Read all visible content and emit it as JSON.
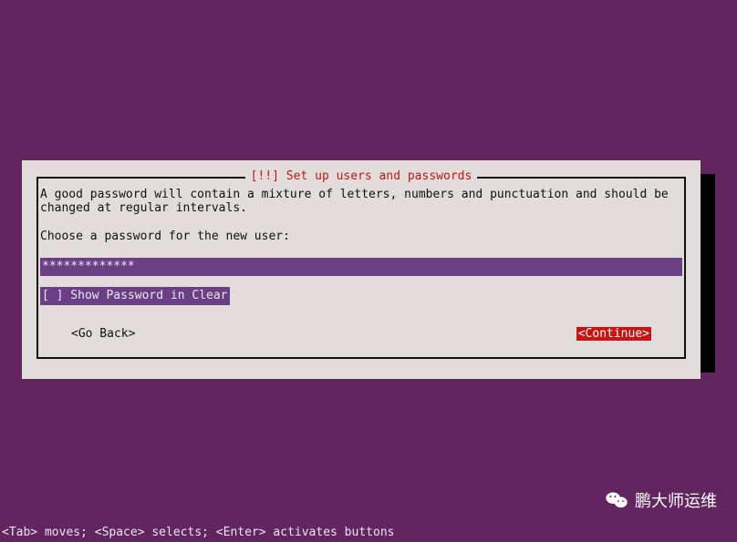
{
  "dialog": {
    "title": "[!!] Set up users and passwords",
    "help1": "A good password will contain a mixture of letters, numbers and punctuation and should be",
    "help2": "changed at regular intervals.",
    "prompt": "Choose a password for the new user:",
    "password_masked": "*************",
    "show_password_label": "[ ] Show Password in Clear",
    "go_back": "<Go Back>",
    "continue": "<Continue>"
  },
  "statusbar": "<Tab> moves; <Space> selects; <Enter> activates buttons",
  "watermark": "鹏大师运维"
}
